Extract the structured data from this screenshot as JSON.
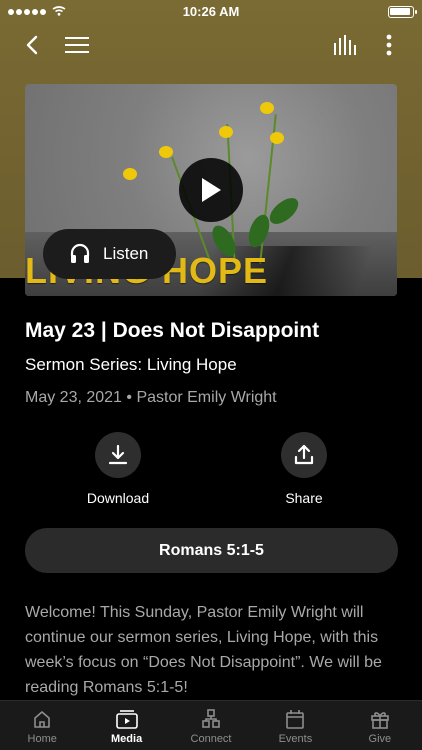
{
  "status": {
    "time": "10:26 AM"
  },
  "media": {
    "overlay_text": "LIVING HOPE",
    "listen_label": "Listen"
  },
  "sermon": {
    "title": "May 23 | Does Not Disappoint",
    "series": "Sermon Series: Living Hope",
    "meta": "May 23, 2021 • Pastor Emily Wright"
  },
  "actions": {
    "download": "Download",
    "share": "Share"
  },
  "scripture": "Romans 5:1-5",
  "description": "Welcome! This Sunday, Pastor Emily Wright will continue our sermon series, Living Hope, with this week’s focus on “Does Not Disappoint”. We will be reading Romans 5:1-5!",
  "tabs": [
    {
      "label": "Home",
      "icon": "home-icon"
    },
    {
      "label": "Media",
      "icon": "media-icon"
    },
    {
      "label": "Connect",
      "icon": "connect-icon"
    },
    {
      "label": "Events",
      "icon": "calendar-icon"
    },
    {
      "label": "Give",
      "icon": "gift-icon"
    }
  ],
  "colors": {
    "header": "#7a6a33",
    "accent": "#e3b915",
    "background": "#000000"
  }
}
